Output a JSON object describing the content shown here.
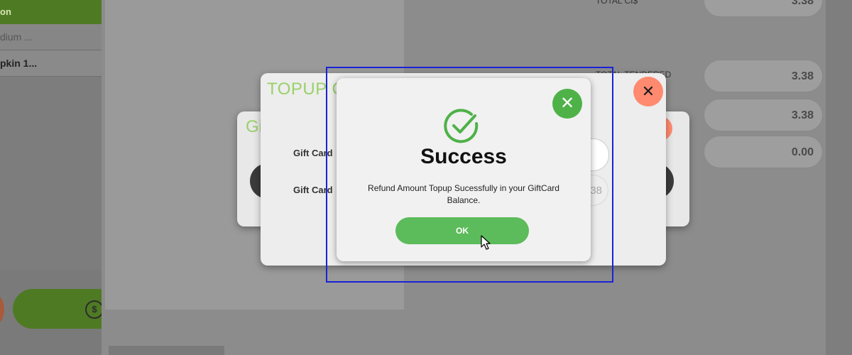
{
  "background": {
    "sidebar": {
      "header_text": "on",
      "rows": [
        "dium ...",
        "pkin 1..."
      ]
    },
    "summary": {
      "rows": [
        {
          "label": "TOTAL CI$",
          "value": "3.38"
        },
        {
          "label": "TOTAL TENDERED",
          "value": "3.38"
        },
        {
          "label": "",
          "value": "3.38"
        },
        {
          "label": "",
          "value": "0.00"
        }
      ]
    }
  },
  "back_dialog": {
    "title": "Gi"
  },
  "topup_dialog": {
    "title": "TOPUP G",
    "close_icon": "close-icon",
    "fields": [
      {
        "label": "Gift Card",
        "value": ""
      },
      {
        "label": "Gift Card",
        "value": "38"
      }
    ]
  },
  "success_dialog": {
    "close_icon": "close-icon",
    "check_icon": "check-circle-icon",
    "title": "Success",
    "message": "Refund Amount Topup Sucessfully in your GiftCard Balance.",
    "ok_label": "OK"
  },
  "colors": {
    "accent_green": "#5cbb5a",
    "close_green": "#4eb248",
    "close_red": "#ff8a70",
    "title_green": "#9bd06a",
    "highlight_box": "#1a22d8"
  }
}
